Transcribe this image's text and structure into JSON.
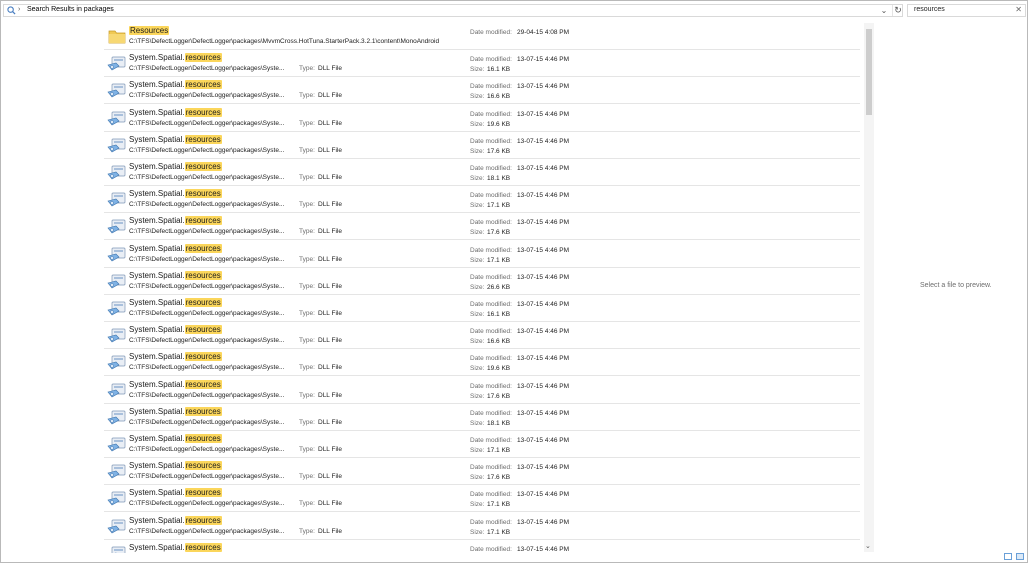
{
  "addressbar": {
    "crumb": "Search Results in packages",
    "separator": "›"
  },
  "search": {
    "value": "resources"
  },
  "preview": {
    "message": "Select a file to preview."
  },
  "labels": {
    "date_modified": "Date modified:",
    "size": "Size:",
    "type": "Type:"
  },
  "colors": {
    "highlight": "#fbd65b"
  },
  "folder_row": {
    "name": "Resources",
    "path": "C:\\TFS\\DefectLogger\\DefectLogger\\packages\\MvvmCross.HotTuna.StarterPack.3.2.1\\content\\MonoAndroid",
    "date": "29-04-15 4:08 PM",
    "icon": "folder-icon"
  },
  "file_rows": {
    "name_prefix": "System.Spatial.",
    "name_match": "resources",
    "path": "C:\\TFS\\DefectLogger\\DefectLogger\\packages\\Syste...",
    "type": "DLL File",
    "icon": "dll-file-icon",
    "items": [
      {
        "date": "13-07-15 4:46 PM",
        "size": "16.1 KB"
      },
      {
        "date": "13-07-15 4:46 PM",
        "size": "16.6 KB"
      },
      {
        "date": "13-07-15 4:46 PM",
        "size": "19.6 KB"
      },
      {
        "date": "13-07-15 4:46 PM",
        "size": "17.6 KB"
      },
      {
        "date": "13-07-15 4:46 PM",
        "size": "18.1 KB"
      },
      {
        "date": "13-07-15 4:46 PM",
        "size": "17.1 KB"
      },
      {
        "date": "13-07-15 4:46 PM",
        "size": "17.6 KB"
      },
      {
        "date": "13-07-15 4:46 PM",
        "size": "17.1 KB"
      },
      {
        "date": "13-07-15 4:46 PM",
        "size": "26.6 KB"
      },
      {
        "date": "13-07-15 4:46 PM",
        "size": "16.1 KB"
      },
      {
        "date": "13-07-15 4:46 PM",
        "size": "16.6 KB"
      },
      {
        "date": "13-07-15 4:46 PM",
        "size": "19.6 KB"
      },
      {
        "date": "13-07-15 4:46 PM",
        "size": "17.6 KB"
      },
      {
        "date": "13-07-15 4:46 PM",
        "size": "18.1 KB"
      },
      {
        "date": "13-07-15 4:46 PM",
        "size": "17.1 KB"
      },
      {
        "date": "13-07-15 4:46 PM",
        "size": "17.6 KB"
      },
      {
        "date": "13-07-15 4:46 PM",
        "size": "17.1 KB"
      },
      {
        "date": "13-07-15 4:46 PM",
        "size": "17.1 KB"
      },
      {
        "date": "13-07-15 4:46 PM",
        "size": ""
      }
    ]
  }
}
